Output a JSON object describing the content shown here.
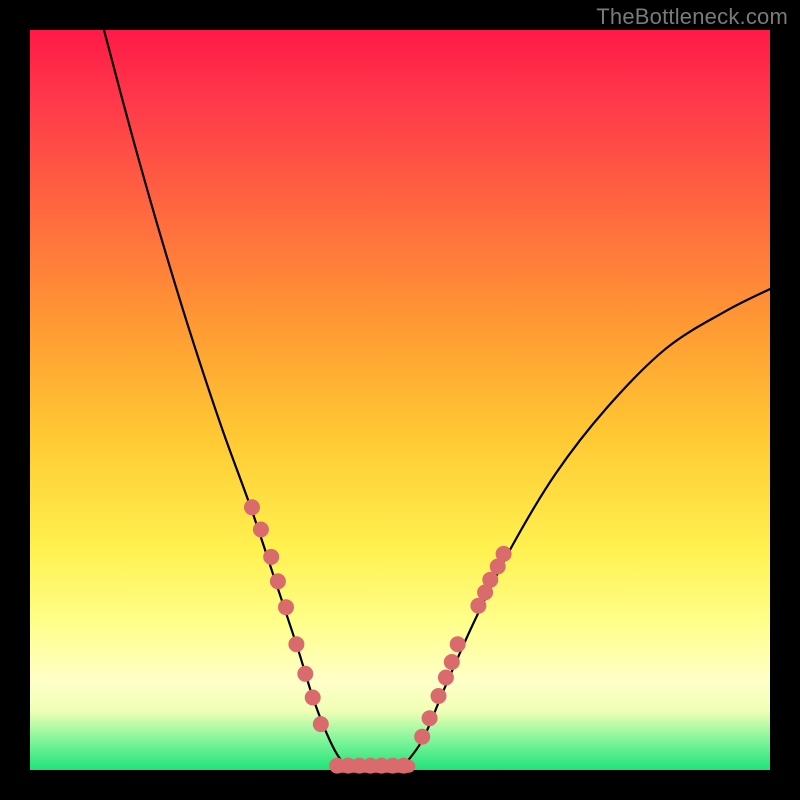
{
  "watermark": "TheBottleneck.com",
  "colors": {
    "background_frame": "#000000",
    "gradient_top": "#ff1a47",
    "gradient_bottom": "#1fe27a",
    "curve": "#000000",
    "marker": "#d96b6d"
  },
  "chart_data": {
    "type": "line",
    "title": "",
    "xlabel": "",
    "ylabel": "",
    "xlim": [
      0,
      100
    ],
    "ylim": [
      0,
      100
    ],
    "series": [
      {
        "name": "left-curve",
        "x": [
          10,
          14,
          18,
          22,
          26,
          30,
          33,
          36,
          38.5,
          41,
          43
        ],
        "y": [
          100,
          85,
          71,
          58,
          46,
          35,
          26,
          17,
          9,
          3,
          0
        ]
      },
      {
        "name": "right-curve",
        "x": [
          50,
          53,
          56,
          60,
          65,
          71,
          78,
          86,
          94,
          100
        ],
        "y": [
          0,
          4,
          11,
          20,
          30,
          40,
          49,
          57,
          62,
          65
        ]
      },
      {
        "name": "valley-bar",
        "x": [
          41,
          52
        ],
        "y": [
          0.5,
          0.5
        ]
      }
    ],
    "markers_left": [
      [
        30,
        35.5
      ],
      [
        31.2,
        32.5
      ],
      [
        32.6,
        28.8
      ],
      [
        33.5,
        25.5
      ],
      [
        34.6,
        22
      ],
      [
        36,
        17
      ],
      [
        37.2,
        13
      ],
      [
        38.2,
        9.8
      ],
      [
        39.3,
        6.2
      ]
    ],
    "markers_right": [
      [
        53,
        4.5
      ],
      [
        54,
        7
      ],
      [
        55.2,
        10
      ],
      [
        56.2,
        12.5
      ],
      [
        57,
        14.6
      ],
      [
        57.8,
        17
      ],
      [
        60.6,
        22.2
      ],
      [
        61.5,
        24
      ],
      [
        62.2,
        25.7
      ],
      [
        63.2,
        27.5
      ],
      [
        64,
        29.2
      ]
    ],
    "markers_bottom": [
      [
        41.5,
        0.6
      ],
      [
        43,
        0.6
      ],
      [
        44.5,
        0.6
      ],
      [
        46,
        0.6
      ],
      [
        47.5,
        0.6
      ],
      [
        49,
        0.6
      ],
      [
        50.5,
        0.6
      ]
    ]
  }
}
